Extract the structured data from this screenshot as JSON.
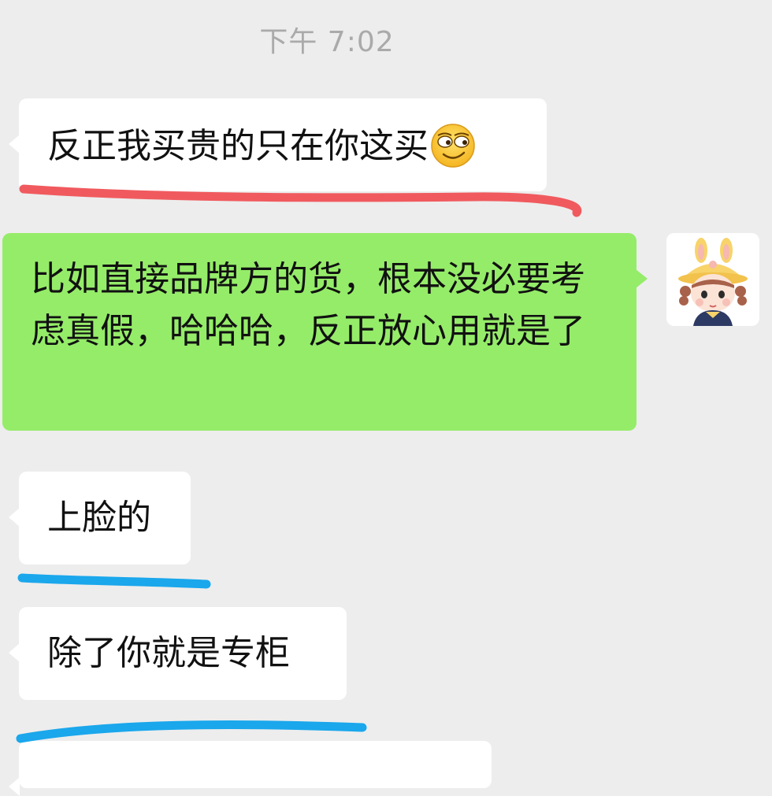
{
  "header": {
    "timestamp": "下午 7:02"
  },
  "messages": [
    {
      "side": "left",
      "text": "反正我买贵的只在你这买",
      "emoji": "smirk-face-icon"
    },
    {
      "side": "right",
      "text": "比如直接品牌方的货，根本没必要考虑真假，哈哈哈，反正放心用就是了"
    },
    {
      "side": "left",
      "text": "上脸的"
    },
    {
      "side": "left",
      "text": "除了你就是专柜"
    }
  ],
  "colors": {
    "background": "#ededed",
    "incoming_bubble": "#ffffff",
    "outgoing_bubble": "#95ec69",
    "red_underline": "#f05a5e",
    "blue_underline": "#1aa7ec"
  },
  "avatar": {
    "icon": "girl-avatar-icon"
  }
}
